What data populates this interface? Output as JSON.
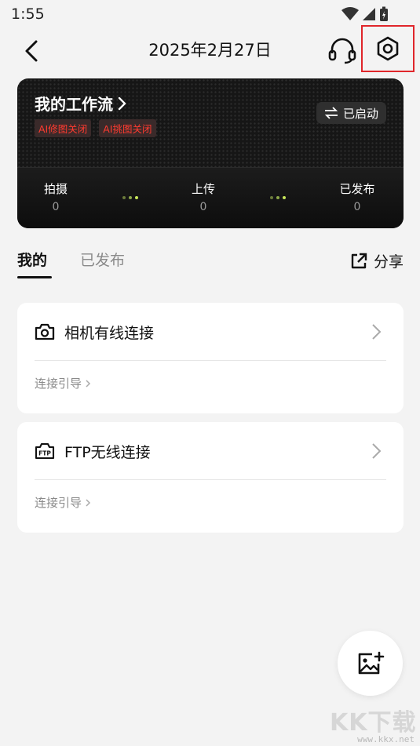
{
  "status_bar": {
    "time": "1:55"
  },
  "header": {
    "title": "2025年2月27日"
  },
  "workflow": {
    "title": "我的工作流",
    "tags": [
      "AI修图关闭",
      "AI挑图关闭"
    ],
    "status": "已启动",
    "stats": [
      {
        "label": "拍摄",
        "value": "0"
      },
      {
        "label": "上传",
        "value": "0"
      },
      {
        "label": "已发布",
        "value": "0"
      }
    ]
  },
  "tabs": {
    "mine": "我的",
    "published": "已发布",
    "share": "分享"
  },
  "connections": [
    {
      "title": "相机有线连接",
      "guide": "连接引导",
      "icon": "camera-icon"
    },
    {
      "title": "FTP无线连接",
      "guide": "连接引导",
      "icon": "ftp-icon"
    }
  ],
  "ftp_icon_text": "FTP",
  "watermark": {
    "logo": "KK下载",
    "url": "www.kkx.net"
  },
  "colors": {
    "highlight_red": "#e0262b",
    "tag_red": "#ff3b30",
    "accent_green": "#c8e65a"
  }
}
